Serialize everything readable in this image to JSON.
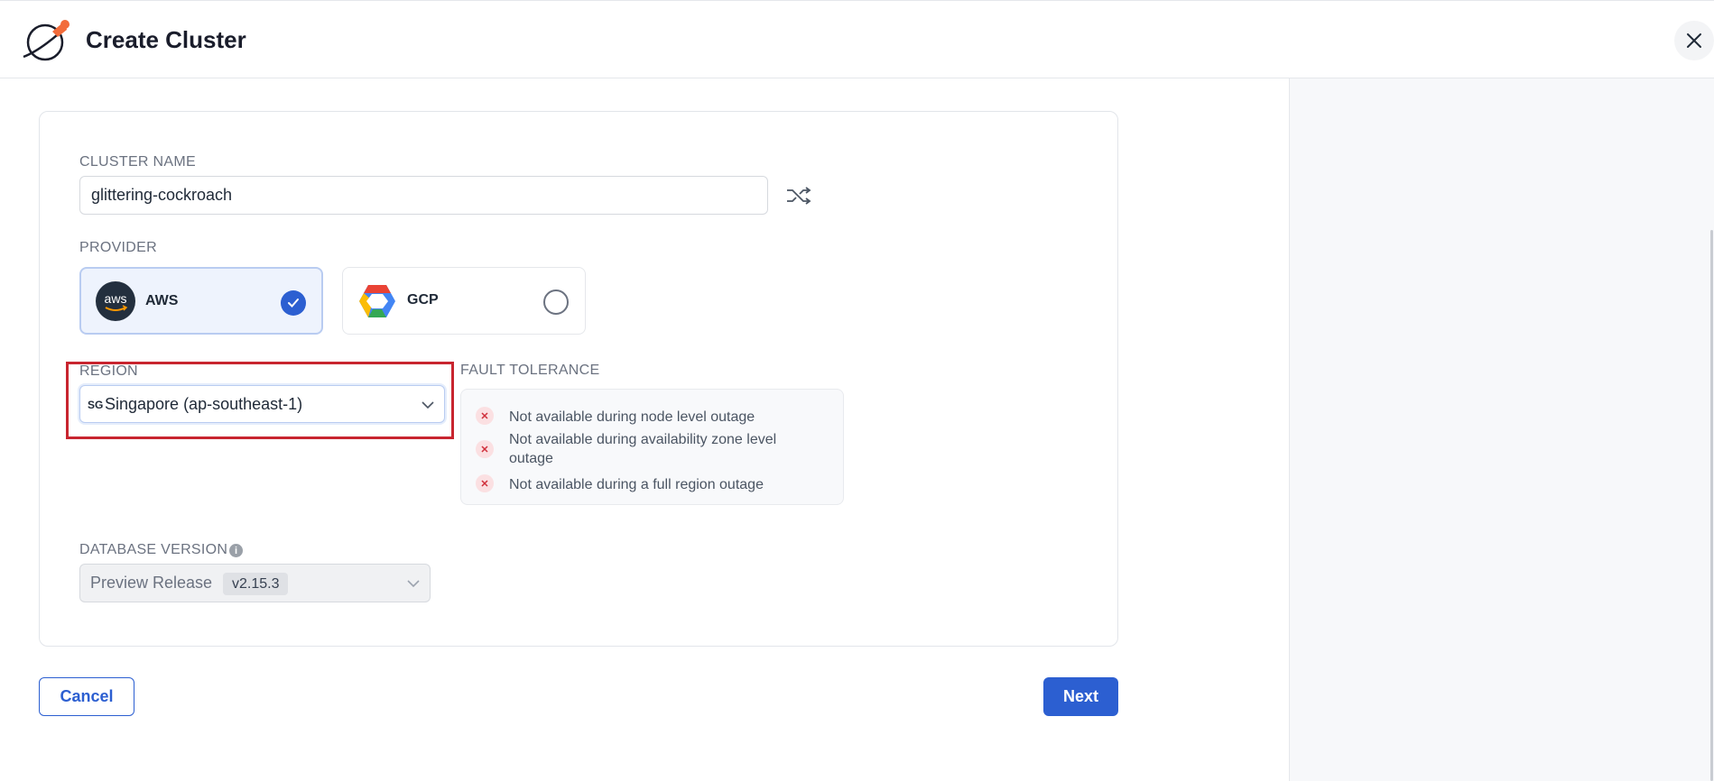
{
  "header": {
    "title": "Create Cluster",
    "logo_icon": "rocket-planet-icon",
    "close_icon": "close-icon"
  },
  "form": {
    "cluster_name": {
      "label": "CLUSTER NAME",
      "value": "glittering-cockroach",
      "shuffle_icon": "shuffle-icon"
    },
    "provider": {
      "label": "PROVIDER",
      "options": [
        {
          "name": "AWS",
          "logo_text": "aws",
          "selected": true
        },
        {
          "name": "GCP",
          "selected": false
        }
      ]
    },
    "region": {
      "label": "REGION",
      "flag_code": "SG",
      "value": "Singapore (ap-southeast-1)"
    },
    "fault_tolerance": {
      "label": "FAULT TOLERANCE",
      "items": [
        "Not available during node level outage",
        "Not available during availability zone level outage",
        "Not available during a full region outage"
      ]
    },
    "database_version": {
      "label": "DATABASE VERSION",
      "value": "Preview Release",
      "badge": "v2.15.3"
    }
  },
  "actions": {
    "cancel": "Cancel",
    "next": "Next"
  },
  "colors": {
    "primary": "#2c5fd1",
    "highlight": "#c8252f",
    "error": "#d0303c"
  }
}
